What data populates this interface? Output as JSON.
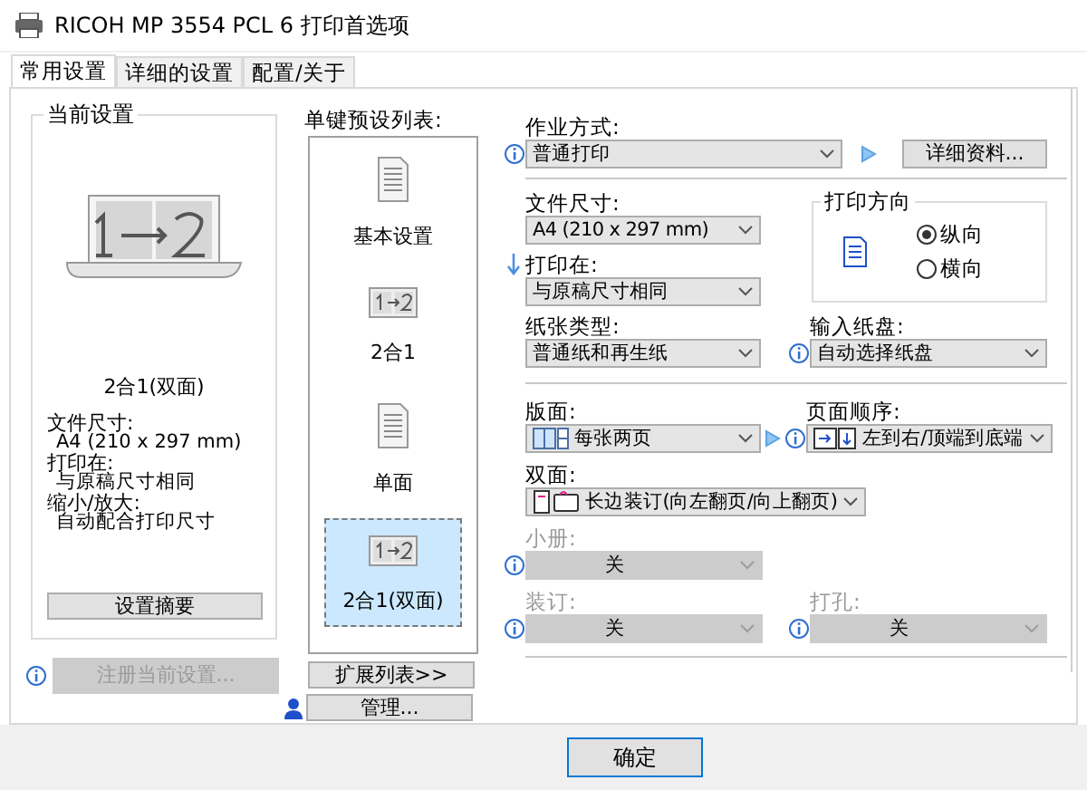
{
  "window": {
    "title": "RICOH MP 3554 PCL 6 打印首选项"
  },
  "tabs": [
    {
      "label": "常用设置",
      "selected": true
    },
    {
      "label": "详细的设置",
      "selected": false
    },
    {
      "label": "配置/关于",
      "selected": false
    }
  ],
  "current_settings": {
    "title": "当前设置",
    "preview_label": "2合1(双面)",
    "details": [
      {
        "label": "文件尺寸:",
        "value": "A4 (210 x 297 mm)"
      },
      {
        "label": "打印在:",
        "value": "与原稿尺寸相同"
      },
      {
        "label": "缩小/放大:",
        "value": "自动配合打印尺寸"
      }
    ],
    "summary_button": "设置摘要",
    "register_button": {
      "label": "注册当前设置...",
      "disabled": true
    }
  },
  "presets": {
    "title": "单键预设列表:",
    "items": [
      {
        "label": "基本设置",
        "kind": "document",
        "selected": false
      },
      {
        "label": "2合1",
        "kind": "two_in_one",
        "selected": false
      },
      {
        "label": "单面",
        "kind": "document",
        "selected": false
      },
      {
        "label": "2合1(双面)",
        "kind": "two_in_one",
        "selected": true
      }
    ],
    "expand_button": "扩展列表>>",
    "manage_button": "管理..."
  },
  "job_type": {
    "label": "作业方式:",
    "value": "普通打印",
    "details_button": "详细资料..."
  },
  "document_size": {
    "label": "文件尺寸:",
    "value": "A4 (210 x 297 mm)"
  },
  "print_on": {
    "label": "打印在:",
    "value": "与原稿尺寸相同"
  },
  "orientation": {
    "title": "打印方向",
    "options": [
      {
        "label": "纵向",
        "selected": true
      },
      {
        "label": "横向",
        "selected": false
      }
    ]
  },
  "paper_type": {
    "label": "纸张类型:",
    "value": "普通纸和再生纸"
  },
  "input_tray": {
    "label": "输入纸盘:",
    "value": "自动选择纸盘"
  },
  "layout": {
    "label": "版面:",
    "value": "每张两页"
  },
  "page_order": {
    "label": "页面顺序:",
    "value": "左到右/顶端到底端"
  },
  "duplex": {
    "label": "双面:",
    "value": "长边装订(向左翻页/向上翻页)"
  },
  "booklet": {
    "label": "小册:",
    "value": "关",
    "disabled": true
  },
  "staple": {
    "label": "装订:",
    "value": "关",
    "disabled": true
  },
  "punch": {
    "label": "打孔:",
    "value": "关",
    "disabled": true
  },
  "ok_button": "确定"
}
